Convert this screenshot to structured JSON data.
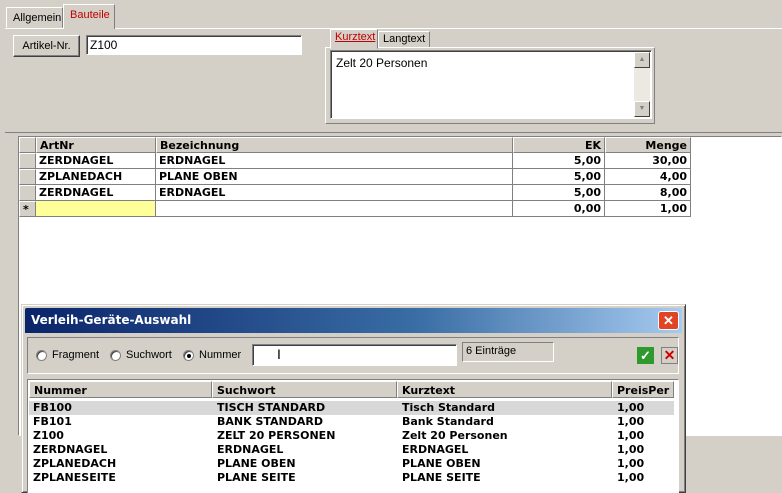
{
  "tabs": [
    {
      "label": "Allgemein",
      "active": false
    },
    {
      "label": "Bauteile",
      "active": true
    }
  ],
  "artikel": {
    "button_label": "Artikel-Nr.",
    "value": "Z100"
  },
  "text_tabs": [
    {
      "label": "Kurztext",
      "active": true
    },
    {
      "label": "Langtext",
      "active": false
    }
  ],
  "kurztext": "Zelt 20 Personen",
  "grid": {
    "columns": [
      "ArtNr",
      "Bezeichnung",
      "EK",
      "Menge"
    ],
    "rows": [
      {
        "marker": "",
        "artnr": "ZERDNAGEL",
        "bezeichnung": "ERDNAGEL",
        "ek": "5,00",
        "menge": "30,00"
      },
      {
        "marker": "",
        "artnr": "ZPLANEDACH",
        "bezeichnung": "PLANE OBEN",
        "ek": "5,00",
        "menge": "4,00"
      },
      {
        "marker": "",
        "artnr": "ZERDNAGEL",
        "bezeichnung": "ERDNAGEL",
        "ek": "5,00",
        "menge": "8,00"
      },
      {
        "marker": "*",
        "artnr": "",
        "bezeichnung": "",
        "ek": "0,00",
        "menge": "1,00"
      }
    ]
  },
  "dialog": {
    "title": "Verleih-Geräte-Auswahl",
    "close_label": "✕",
    "radios": [
      {
        "label": "Fragment",
        "checked": false
      },
      {
        "label": "Suchwort",
        "checked": false
      },
      {
        "label": "Nummer",
        "checked": true
      }
    ],
    "search_value": "",
    "count": "6 Einträge",
    "ok_label": "✓",
    "cancel_label": "✕",
    "columns": [
      "Nummer",
      "Suchwort",
      "Kurztext",
      "PreisPer"
    ],
    "rows": [
      {
        "nummer": "FB100",
        "suchwort": "TISCH STANDARD",
        "kurztext": "Tisch Standard",
        "preis": "1,00",
        "selected": true
      },
      {
        "nummer": "FB101",
        "suchwort": "BANK STANDARD",
        "kurztext": "Bank Standard",
        "preis": "1,00",
        "selected": false
      },
      {
        "nummer": "Z100",
        "suchwort": "ZELT 20 PERSONEN",
        "kurztext": "Zelt 20 Personen",
        "preis": "1,00",
        "selected": false
      },
      {
        "nummer": "ZERDNAGEL",
        "suchwort": "ERDNAGEL",
        "kurztext": "ERDNAGEL",
        "preis": "1,00",
        "selected": false
      },
      {
        "nummer": "ZPLANEDACH",
        "suchwort": "PLANE OBEN",
        "kurztext": "PLANE OBEN",
        "preis": "1,00",
        "selected": false
      },
      {
        "nummer": "ZPLANESEITE",
        "suchwort": "PLANE SEITE",
        "kurztext": "PLANE SEITE",
        "preis": "1,00",
        "selected": false
      }
    ]
  },
  "colors": {
    "accent_red": "#c00000",
    "new_row_yellow": "#ffff99",
    "title_blue": "#0a246a",
    "close_red": "#e04424",
    "ok_green": "#2e9a2e"
  }
}
